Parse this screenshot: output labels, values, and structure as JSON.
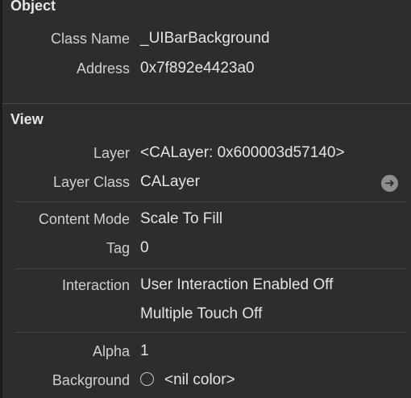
{
  "object_section": {
    "title": "Object",
    "class_name_label": "Class Name",
    "class_name_value": "_UIBarBackground",
    "address_label": "Address",
    "address_value": "0x7f892e4423a0"
  },
  "view_section": {
    "title": "View",
    "layer_label": "Layer",
    "layer_value": "<CALayer: 0x600003d57140>",
    "layer_class_label": "Layer Class",
    "layer_class_value": "CALayer",
    "content_mode_label": "Content Mode",
    "content_mode_value": "Scale To Fill",
    "tag_label": "Tag",
    "tag_value": "0",
    "interaction_label": "Interaction",
    "interaction_value_1": "User Interaction Enabled Off",
    "interaction_value_2": "Multiple Touch Off",
    "alpha_label": "Alpha",
    "alpha_value": "1",
    "background_label": "Background",
    "background_value": "<nil color>",
    "navigate_icon": "arrow-right-circle-icon",
    "color_icon": "empty-circle-icon"
  }
}
